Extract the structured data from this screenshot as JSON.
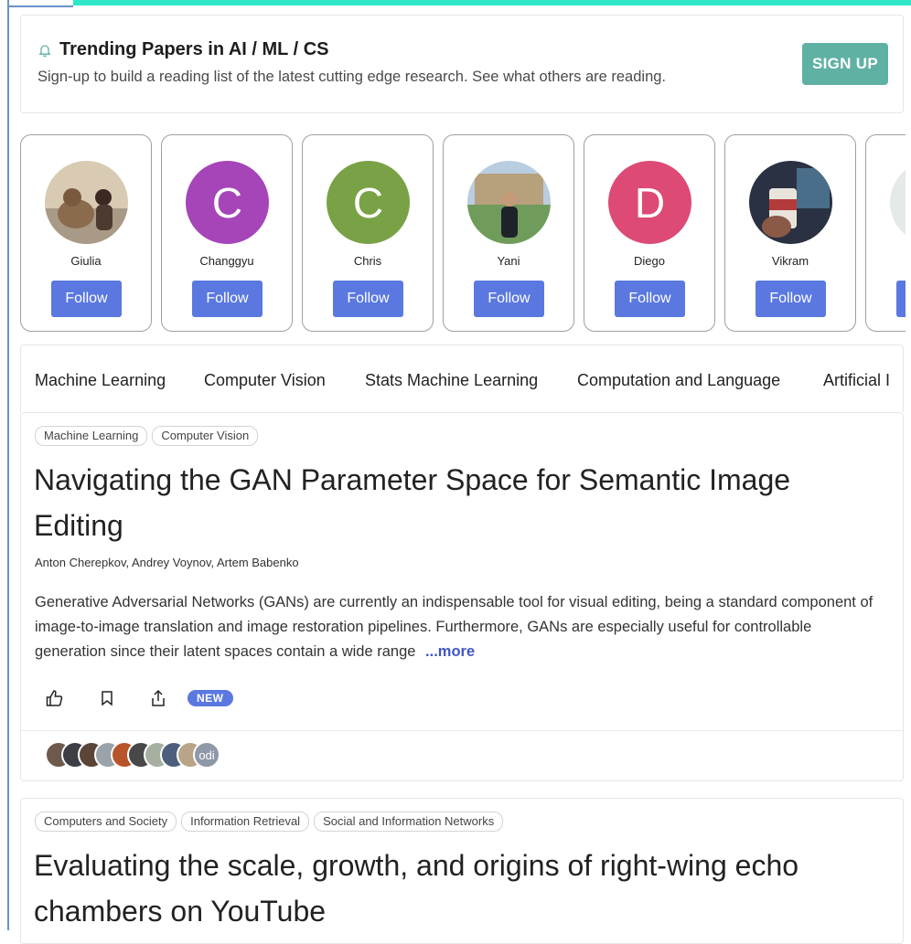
{
  "banner": {
    "title": "Trending Papers in AI / ML / CS",
    "subtitle": "Sign-up to build a reading list of the latest cutting edge research. See what others are reading.",
    "signup_label": "SIGN UP"
  },
  "people": [
    {
      "name": "Giulia",
      "initial": "",
      "color": "#c9b79a",
      "photo": true
    },
    {
      "name": "Changgyu",
      "initial": "C",
      "color": "#a545b8",
      "photo": false
    },
    {
      "name": "Chris",
      "initial": "C",
      "color": "#78a245",
      "photo": false
    },
    {
      "name": "Yani",
      "initial": "",
      "color": "#6f9c5a",
      "photo": true
    },
    {
      "name": "Diego",
      "initial": "D",
      "color": "#dc4a75",
      "photo": false
    },
    {
      "name": "Vikram",
      "initial": "",
      "color": "#2a3142",
      "photo": true
    }
  ],
  "follow_label": "Follow",
  "topics": [
    "Machine Learning",
    "Computer Vision",
    "Stats Machine Learning",
    "Computation and Language",
    "Artificial I"
  ],
  "papers": [
    {
      "tags": [
        "Machine Learning",
        "Computer Vision"
      ],
      "title_line1": "Navigating the GAN Parameter Space for Semantic Image",
      "title_line2": "Editing",
      "authors": "Anton Cherepkov, Andrey Voynov, Artem Babenko",
      "abstract": "Generative Adversarial Networks (GANs) are currently an indispensable tool for visual editing, being a standard component of image-to-image translation and image restoration pipelines. Furthermore, GANs are especially useful for controllable generation since their latent spaces contain a wide range",
      "more_label": "...more",
      "badge": "NEW",
      "readers_last_label": "odi"
    },
    {
      "tags": [
        "Computers and Society",
        "Information Retrieval",
        "Social and Information Networks"
      ],
      "title_line1": "Evaluating the scale, growth, and origins of right-wing echo",
      "title_line2": "chambers on YouTube"
    }
  ],
  "colors": {
    "accent": "#5a78e0",
    "signup": "#5fb1a4",
    "topbar": "#2ee6c8",
    "more_link": "#4056c4"
  }
}
